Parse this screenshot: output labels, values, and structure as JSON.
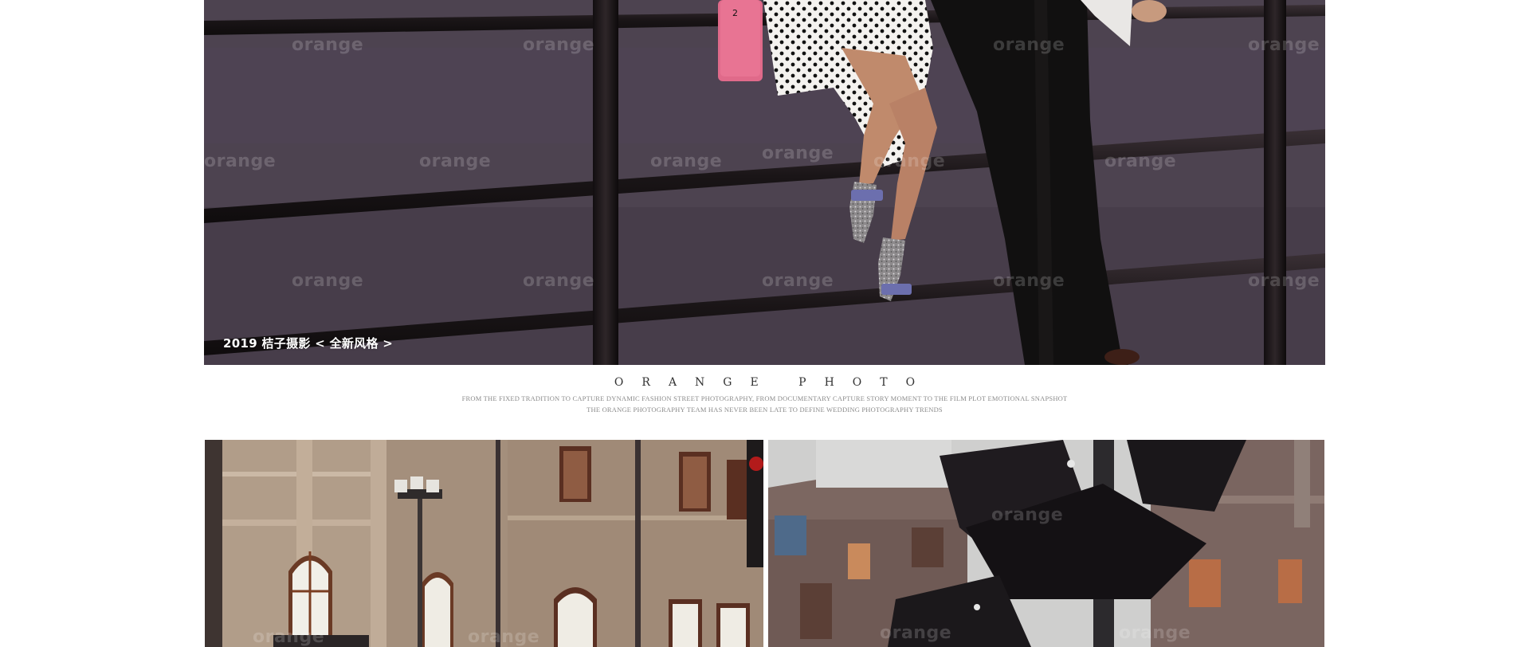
{
  "hero": {
    "caption": "2019 桔子摄影 < 全新风格 >",
    "watermark": "orange"
  },
  "brand": {
    "title": "ORANGE PHOTO",
    "line1": "FROM THE FIXED TRADITION TO CAPTURE DYNAMIC FASHION STREET PHOTOGRAPHY, FROM DOCUMENTARY CAPTURE STORY MOMENT TO THE FILM PLOT EMOTIONAL SNAPSHOT",
    "line2": "THE ORANGE PHOTOGRAPHY TEAM HAS NEVER BEEN LATE TO DEFINE WEDDING PHOTOGRAPHY TRENDS"
  },
  "gallery": {
    "left_watermark": "orange",
    "right_watermark": "orange"
  },
  "colors": {
    "background": "#ffffff",
    "hero_asphalt": "#4c4250",
    "railing": "#1c1719",
    "bag_pink": "#e06a8a",
    "building_stone": "#a38e7a",
    "sky": "#c7c7c6",
    "brand_title": "#333333",
    "brand_text": "#8a8a8a"
  }
}
